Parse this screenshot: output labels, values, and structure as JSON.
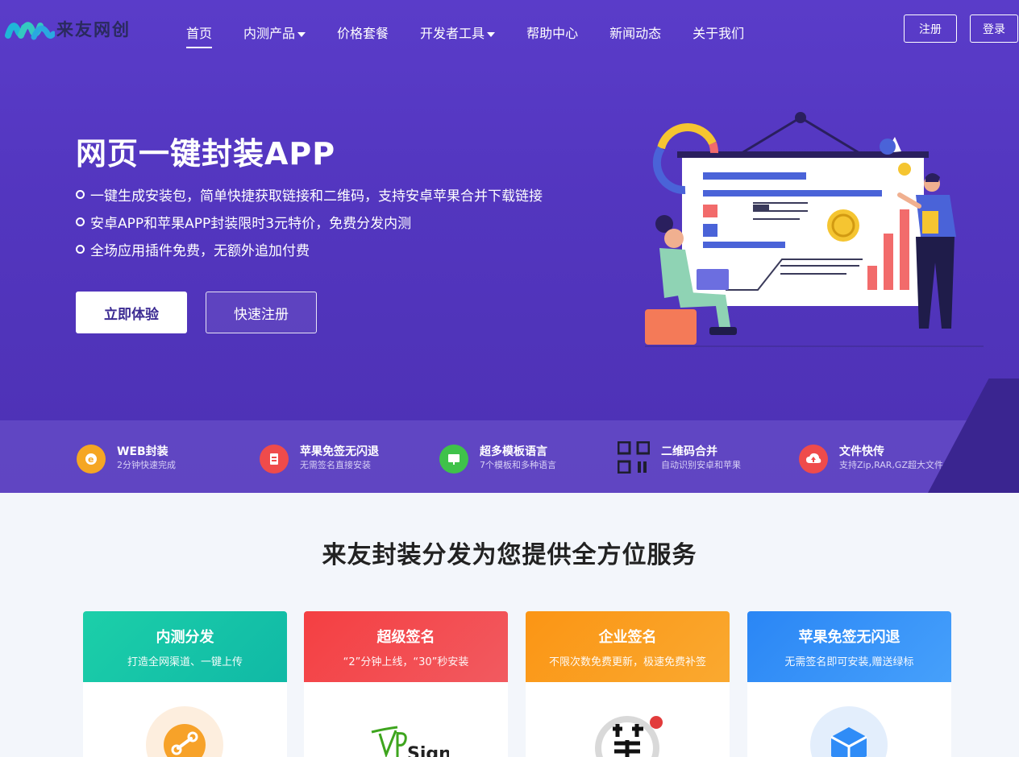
{
  "brand": {
    "name": "来友网创",
    "colors": {
      "hero": "#5a3cc9",
      "accent": "#3b2a92"
    }
  },
  "nav": {
    "items": [
      {
        "label": "首页",
        "active": true,
        "dropdown": false
      },
      {
        "label": "内测产品",
        "active": false,
        "dropdown": true
      },
      {
        "label": "价格套餐",
        "active": false,
        "dropdown": false
      },
      {
        "label": "开发者工具",
        "active": false,
        "dropdown": true
      },
      {
        "label": "帮助中心",
        "active": false,
        "dropdown": false
      },
      {
        "label": "新闻动态",
        "active": false,
        "dropdown": false
      },
      {
        "label": "关于我们",
        "active": false,
        "dropdown": false
      }
    ],
    "register": "注册",
    "login": "登录"
  },
  "hero": {
    "title": "网页一键封装APP",
    "bullets": [
      "一键生成安装包，简单快捷获取链接和二维码，支持安卓苹果合并下载链接",
      "安卓APP和苹果APP封装限时3元特价，免费分发内测",
      "全场应用插件免费，无额外追加付费"
    ],
    "primary_cta": "立即体验",
    "secondary_cta": "快速注册"
  },
  "features": [
    {
      "title": "WEB封装",
      "sub": "2分钟快速完成",
      "icon": "e-icon",
      "color": "#f5a623"
    },
    {
      "title": "苹果免签无闪退",
      "sub": "无需签名直接安装",
      "icon": "document-icon",
      "color": "#ef4b4b"
    },
    {
      "title": "超多模板语言",
      "sub": "7个模板和多种语言",
      "icon": "monitor-icon",
      "color": "#3fc24a"
    },
    {
      "title": "二维码合并",
      "sub": "自动识别安卓和苹果",
      "icon": "qrcode-icon",
      "color": "#1e1e2e"
    },
    {
      "title": "文件快传",
      "sub": "支持Zip,RAR,GZ超大文件",
      "icon": "cloud-upload-icon",
      "color": "#ef4b4b"
    }
  ],
  "services": {
    "title": "来友封装分发为您提供全方位服务",
    "cards": [
      {
        "title": "内测分发",
        "sub": "打造全网渠道、一键上传",
        "from": "#18c7a8",
        "to": "#11b8a5",
        "circle": "#fdeede"
      },
      {
        "title": "超级签名",
        "sub": "“2”分钟上线，“30”秒安装",
        "from": "#f5484b",
        "to": "#f2545a",
        "circle": "#ffffff"
      },
      {
        "title": "企业签名",
        "sub": "不限次数免费更新，极速免费补签",
        "from": "#fb9a1b",
        "to": "#f9a52a",
        "circle": "#ffffff"
      },
      {
        "title": "苹果免签无闪退",
        "sub": "无需签名即可安装,赠送绿标",
        "from": "#2f8cf7",
        "to": "#3d97fb",
        "circle": "#e3eefc"
      }
    ]
  }
}
